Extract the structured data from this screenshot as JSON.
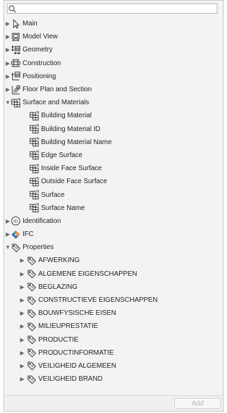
{
  "search": {
    "value": "",
    "icon": "search-icon"
  },
  "tree": {
    "main": "Main",
    "model_view": "Model View",
    "geometry": "Geometry",
    "construction": "Construction",
    "positioning": "Positioning",
    "floor_plan": "Floor Plan and Section",
    "surface": {
      "label": "Surface and Materials",
      "children": [
        "Building Material",
        "Building Material ID",
        "Building Material Name",
        "Edge Surface",
        "Inside Face Surface",
        "Outside Face Surface",
        "Surface",
        "Surface Name"
      ]
    },
    "identification": "Identification",
    "ifc": "IFC",
    "properties": {
      "label": "Properties",
      "children": [
        "AFWERKING",
        "ALGEMENE EIGENSCHAPPEN",
        "BEGLAZING",
        "CONSTRUCTIEVE EIGENSCHAPPEN",
        "BOUWFYSISCHE EISEN",
        "MILIEUPRESTATIE",
        "PRODUCTIE",
        "PRODUCTINFORMATIE",
        "VEILIGHEID ALGEMEEN",
        "VEILIGHEID BRAND"
      ]
    }
  },
  "footer": {
    "add_label": "Add"
  },
  "colors": {
    "panel_bg": "#f3f3f3",
    "ifc_accent": "#d53a4a",
    "disabled_text": "#b5b5b5"
  }
}
